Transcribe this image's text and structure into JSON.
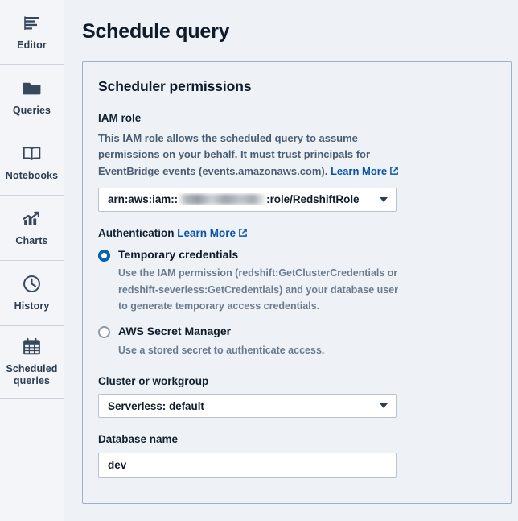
{
  "sidebar": {
    "items": [
      {
        "label": "Editor",
        "icon": "editor-icon"
      },
      {
        "label": "Queries",
        "icon": "folder-icon"
      },
      {
        "label": "Notebooks",
        "icon": "book-icon"
      },
      {
        "label": "Charts",
        "icon": "chart-icon"
      },
      {
        "label": "History",
        "icon": "clock-icon"
      },
      {
        "label": "Scheduled queries",
        "icon": "calendar-icon"
      }
    ]
  },
  "page": {
    "title": "Schedule query"
  },
  "panel": {
    "title": "Scheduler permissions",
    "iam_role": {
      "label": "IAM role",
      "description_part1": "This IAM role allows the scheduled query to assume permissions on your behalf. It must trust principals for EventBridge events (events.amazonaws.com). ",
      "learn_more_label": "Learn More",
      "selected_prefix": "arn:aws:iam::",
      "selected_suffix": ":role/RedshiftRole",
      "redacted": true
    },
    "authentication": {
      "label": "Authentication ",
      "learn_more_label": "Learn More",
      "options": [
        {
          "label": "Temporary credentials",
          "description": "Use the IAM permission (redshift:GetClusterCredentials or redshift-severless:GetCredentials) and your database user to generate temporary access credentials.",
          "selected": true
        },
        {
          "label": "AWS Secret Manager",
          "description": "Use a stored secret to authenticate access.",
          "selected": false
        }
      ]
    },
    "cluster": {
      "label": "Cluster or workgroup",
      "value": "Serverless: default"
    },
    "database": {
      "label": "Database name",
      "value": "dev",
      "placeholder": "Database name"
    }
  },
  "colors": {
    "accent": "#0962ad",
    "link": "#0a53a8",
    "page_bg": "#eef1f5",
    "panel_border": "#9fb0c3",
    "sidebar_bg": "#f3f5f8",
    "text": "#0f1b2a",
    "muted": "#6a7b8d"
  }
}
